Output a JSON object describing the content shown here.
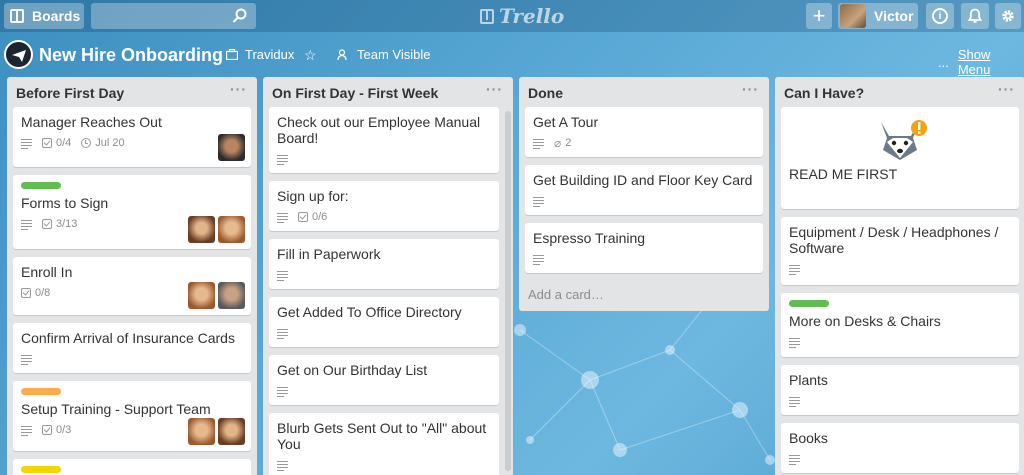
{
  "topbar": {
    "boards_label": "Boards",
    "search_placeholder": "",
    "logo_text": "Trello",
    "add_label": "+",
    "user_name": "Victor",
    "info_label": "i"
  },
  "board": {
    "title": "New Hire Onboarding",
    "org": "Travidux",
    "visibility": "Team Visible",
    "show_menu": "Show Menu",
    "more": "..."
  },
  "lists": [
    {
      "title": "Before First Day",
      "cards": [
        {
          "title": "Manager Reaches Out",
          "checklist": "0/4",
          "due": "Jul 20"
        },
        {
          "title": "Forms to Sign",
          "checklist": "3/13",
          "label_color": "#61bd4f"
        },
        {
          "title": "Enroll In",
          "checklist": "0/8"
        },
        {
          "title": "Confirm Arrival of Insurance Cards"
        },
        {
          "title": "Setup Training - Support Team",
          "checklist": "0/3",
          "label_color": "#ffab4a"
        }
      ],
      "extra_label_color": "#f2d600"
    },
    {
      "title": "On First Day - First Week",
      "cards": [
        {
          "title": "Check out our Employee Manual Board!"
        },
        {
          "title": "Sign up for:",
          "checklist": "0/6"
        },
        {
          "title": "Fill in Paperwork"
        },
        {
          "title": "Get Added To Office Directory"
        },
        {
          "title": "Get on Our Birthday List"
        },
        {
          "title": "Blurb Gets Sent Out to \"All\" about You"
        }
      ]
    },
    {
      "title": "Done",
      "cards": [
        {
          "title": "Get A Tour",
          "attachments": "2"
        },
        {
          "title": "Get Building ID and Floor Key Card"
        },
        {
          "title": "Espresso Training"
        }
      ],
      "add_card": "Add a card…"
    },
    {
      "title": "Can I Have?",
      "cards": [
        {
          "title": "READ ME FIRST"
        },
        {
          "title": "Equipment / Desk / Headphones / Software"
        },
        {
          "title": "More on Desks & Chairs",
          "label_color": "#61bd4f"
        },
        {
          "title": "Plants"
        },
        {
          "title": "Books"
        }
      ]
    }
  ],
  "list_menu": "···"
}
